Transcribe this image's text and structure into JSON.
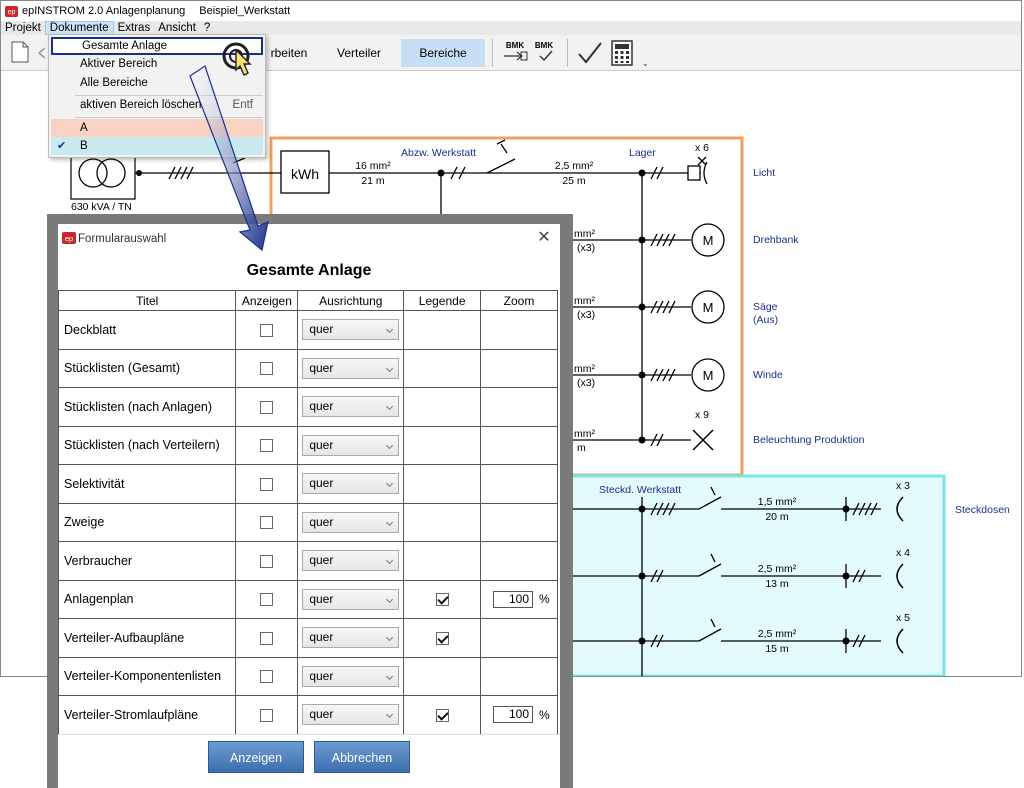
{
  "window": {
    "app_title": "epINSTROM 2.0 Anlagenplanung",
    "document_title": "Beispiel_Werkstatt"
  },
  "menubar": {
    "items": [
      "Projekt",
      "Dokumente",
      "Extras",
      "Ansicht",
      "?"
    ],
    "active": "Dokumente"
  },
  "toolbar": {
    "buttons": {
      "bearbeiten": "rbeiten",
      "verteiler": "Verteiler",
      "bereiche": "Bereiche",
      "bmk1": "BMK",
      "bmk2": "BMK"
    },
    "icons": [
      "new-document-icon",
      "back-arrow-icon",
      "checkmark-icon",
      "calculator-icon"
    ]
  },
  "dokumente_menu": {
    "items": [
      {
        "label": "Gesamte Anlage",
        "highlighted": true
      },
      {
        "label": "Aktiver Bereich"
      },
      {
        "label": "Alle Bereiche"
      },
      {
        "label": "aktiven Bereich löschen",
        "shortcut": "Entf"
      },
      {
        "label": "A",
        "color": "#f8d3c3"
      },
      {
        "label": "B",
        "color": "#c9eaf0",
        "checked": true
      }
    ]
  },
  "diagram": {
    "transformer_label": "630 kVA / TN",
    "meter_label": "kWh",
    "feed_cable": {
      "section": "16 mm²",
      "length": "21 m"
    },
    "area_orange": {
      "color": "#f0a060",
      "label": "Abzw. Werkstatt",
      "sublabel": "Lager"
    },
    "area_cyan": {
      "color": "#79e5e8",
      "fill": "#e3fbfc",
      "label": "Steckd. Werkstatt"
    },
    "branches": [
      {
        "cable_section": "2,5 mm²",
        "cable_length": "25 m",
        "count": "x 6",
        "name": "Licht",
        "symbol": "lamp"
      },
      {
        "cable_section": "mm²",
        "cable_length": "(x3)",
        "name": "Drehbank",
        "symbol": "motor",
        "motor_label": "M"
      },
      {
        "cable_section": "mm²",
        "cable_length": "(x3)",
        "name": "Säge",
        "name2": "(Aus)",
        "symbol": "motor",
        "motor_label": "M"
      },
      {
        "cable_section": "mm²",
        "cable_length": "(x3)",
        "name": "Winde",
        "symbol": "motor",
        "motor_label": "M"
      },
      {
        "cable_section": "mm²",
        "cable_length": "m",
        "count": "x 9",
        "name": "Beleuchtung Produktion",
        "symbol": "light"
      }
    ],
    "socket_branches": [
      {
        "cable_section": "1,5 mm²",
        "cable_length": "20 m",
        "count": "x 3"
      },
      {
        "cable_section": "2,5 mm²",
        "cable_length": "13 m",
        "count": "x 4"
      },
      {
        "cable_section": "2,5 mm²",
        "cable_length": "15 m",
        "count": "x 5"
      }
    ],
    "socket_group_name": "Steckdosen"
  },
  "dialog": {
    "window_title": "Formularauswahl",
    "heading": "Gesamte Anlage",
    "columns": [
      "Titel",
      "Anzeigen",
      "Ausrichtung",
      "Legende",
      "Zoom"
    ],
    "rows": [
      {
        "title": "Deckblatt",
        "show": false,
        "orientation": "quer",
        "legend": null,
        "zoom": null
      },
      {
        "title": "Stücklisten (Gesamt)",
        "show": false,
        "orientation": "quer",
        "legend": null,
        "zoom": null
      },
      {
        "title": "Stücklisten (nach Anlagen)",
        "show": false,
        "orientation": "quer",
        "legend": null,
        "zoom": null
      },
      {
        "title": "Stücklisten (nach Verteilern)",
        "show": false,
        "orientation": "quer",
        "legend": null,
        "zoom": null
      },
      {
        "title": "Selektivität",
        "show": false,
        "orientation": "quer",
        "legend": null,
        "zoom": null
      },
      {
        "title": "Zweige",
        "show": false,
        "orientation": "quer",
        "legend": null,
        "zoom": null
      },
      {
        "title": "Verbraucher",
        "show": false,
        "orientation": "quer",
        "legend": null,
        "zoom": null
      },
      {
        "title": "Anlagenplan",
        "show": false,
        "orientation": "quer",
        "legend": true,
        "zoom": "100"
      },
      {
        "title": "Verteiler-Aufbaupläne",
        "show": false,
        "orientation": "quer",
        "legend": true,
        "zoom": null
      },
      {
        "title": "Verteiler-Komponentenlisten",
        "show": false,
        "orientation": "quer",
        "legend": null,
        "zoom": null
      },
      {
        "title": "Verteiler-Stromlaufpläne",
        "show": false,
        "orientation": "quer",
        "legend": true,
        "zoom": "100"
      }
    ],
    "zoom_unit": "%",
    "buttons": {
      "show": "Anzeigen",
      "cancel": "Abbrechen"
    }
  },
  "annotation": {
    "arrow_color": "#1a2f8a",
    "cursor": "pointer-hand-click-icon"
  }
}
